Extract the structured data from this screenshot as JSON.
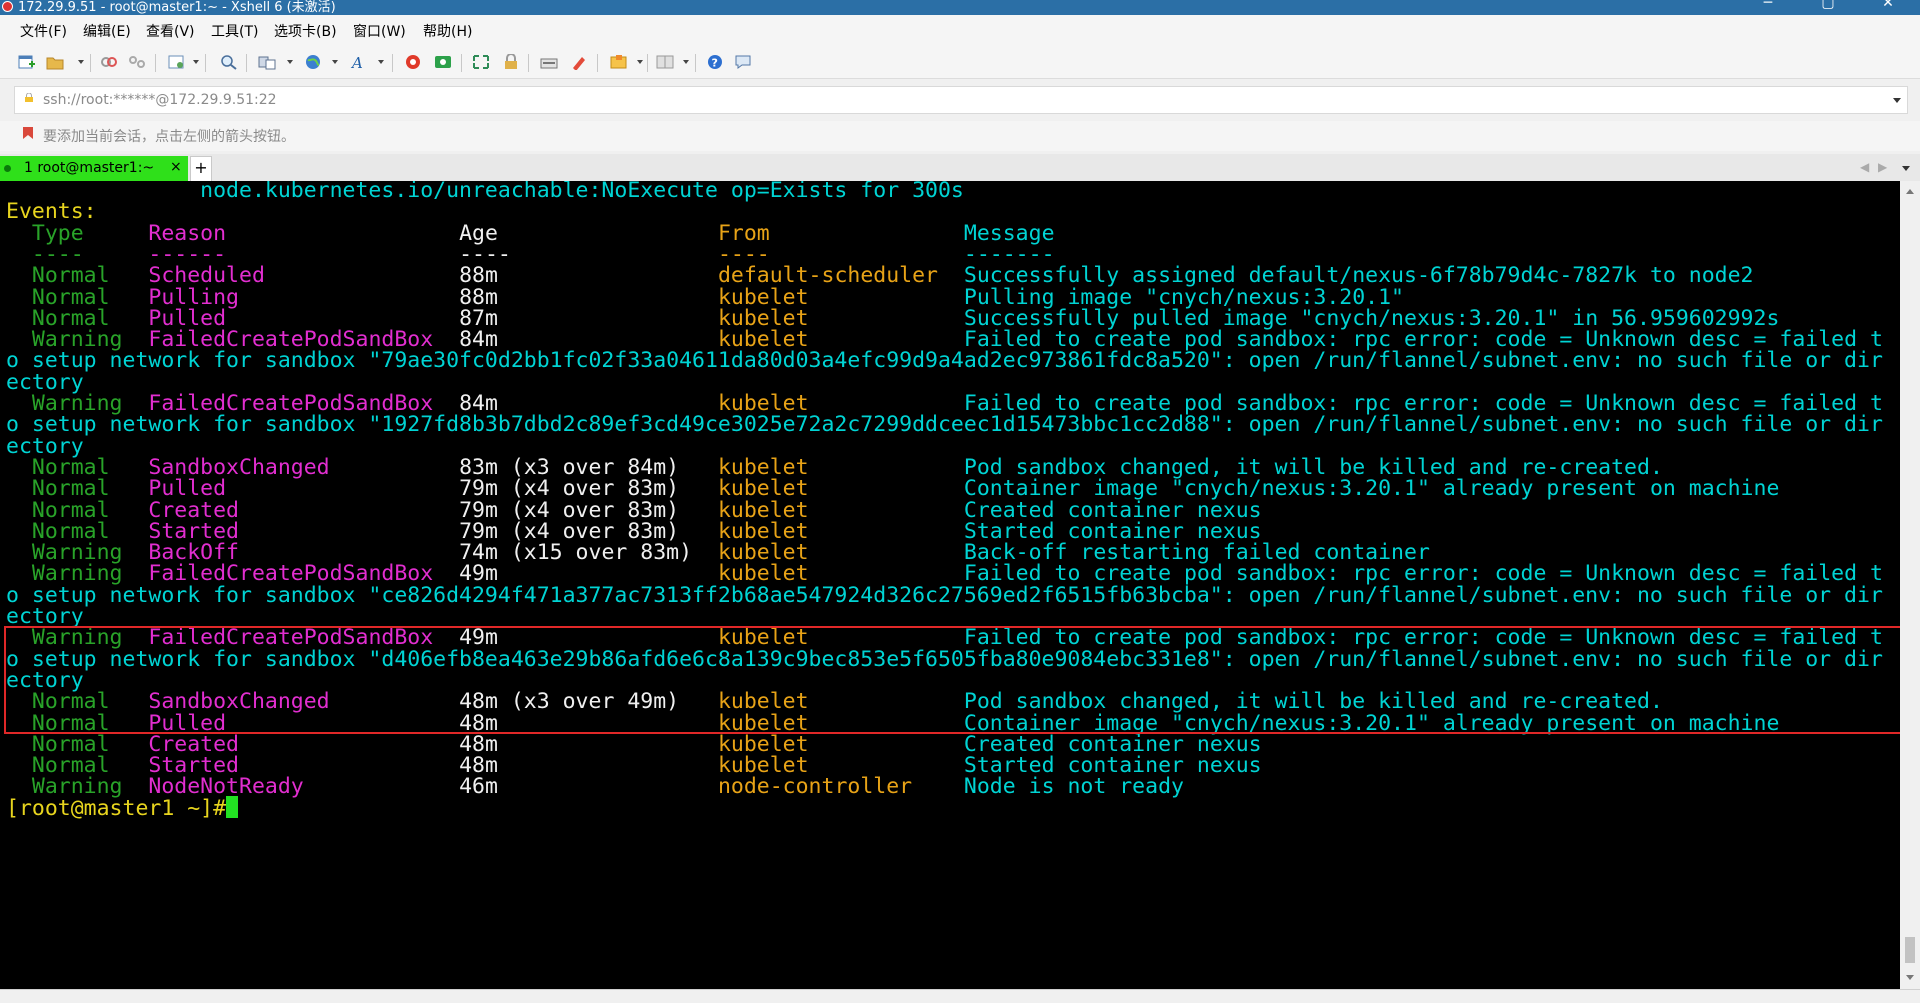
{
  "window": {
    "title": "172.29.9.51 - root@master1:~ - Xshell 6 (未激活)"
  },
  "menu": [
    "文件(F)",
    "编辑(E)",
    "查看(V)",
    "工具(T)",
    "选项卡(B)",
    "窗口(W)",
    "帮助(H)"
  ],
  "address": {
    "value": "ssh://root:******@172.29.9.51:22"
  },
  "hint": {
    "text": "要添加当前会话，点击左侧的箭头按钮。"
  },
  "tabs": {
    "active_label": "1 root@master1:~",
    "close": "×",
    "new": "+"
  },
  "terminal": {
    "lines": [
      [
        {
          "t": "               node.kubernetes.io/unreachable:NoExecute op=Exists for 300s",
          "c": "def"
        }
      ],
      [
        {
          "t": "Events:",
          "c": "yellow"
        }
      ],
      [
        {
          "t": "  Type     ",
          "c": "green"
        },
        {
          "t": "Reason                  ",
          "c": "magenta"
        },
        {
          "t": "Age                 ",
          "c": "white"
        },
        {
          "t": "From               ",
          "c": "orange"
        },
        {
          "t": "Message",
          "c": "msg"
        }
      ],
      [
        {
          "t": "  ----     ",
          "c": "green"
        },
        {
          "t": "------                  ",
          "c": "magenta"
        },
        {
          "t": "----                ",
          "c": "white"
        },
        {
          "t": "----               ",
          "c": "orange"
        },
        {
          "t": "-------",
          "c": "msg"
        }
      ],
      [
        {
          "t": "  Normal   ",
          "c": "green"
        },
        {
          "t": "Scheduled               ",
          "c": "magenta"
        },
        {
          "t": "88m                 ",
          "c": "white"
        },
        {
          "t": "default-scheduler  ",
          "c": "orange"
        },
        {
          "t": "Successfully assigned default/nexus-6f78b79d4c-7827k to node2",
          "c": "msg"
        }
      ],
      [
        {
          "t": "  Normal   ",
          "c": "green"
        },
        {
          "t": "Pulling                 ",
          "c": "magenta"
        },
        {
          "t": "88m                 ",
          "c": "white"
        },
        {
          "t": "kubelet            ",
          "c": "orange"
        },
        {
          "t": "Pulling image \"cnych/nexus:3.20.1\"",
          "c": "msg"
        }
      ],
      [
        {
          "t": "  Normal   ",
          "c": "green"
        },
        {
          "t": "Pulled                  ",
          "c": "magenta"
        },
        {
          "t": "87m                 ",
          "c": "white"
        },
        {
          "t": "kubelet            ",
          "c": "orange"
        },
        {
          "t": "Successfully pulled image \"cnych/nexus:3.20.1\" in 56.959602992s",
          "c": "msg"
        }
      ],
      [
        {
          "t": "  Warning  ",
          "c": "green"
        },
        {
          "t": "FailedCreatePodSandBox  ",
          "c": "magenta"
        },
        {
          "t": "84m                 ",
          "c": "white"
        },
        {
          "t": "kubelet            ",
          "c": "orange"
        },
        {
          "t": "Failed to create pod sandbox: rpc error: code = Unknown desc = failed t",
          "c": "msg"
        }
      ],
      [
        {
          "t": "o setup network for sandbox \"79ae30fc0d2bb1fc02f33a04611da80d03a4efc99d9a4ad2ec973861fdc8a520\": open /run/flannel/subnet.env: no such file or dir",
          "c": "msg"
        }
      ],
      [
        {
          "t": "ectory",
          "c": "msg"
        }
      ],
      [
        {
          "t": "  Warning  ",
          "c": "green"
        },
        {
          "t": "FailedCreatePodSandBox  ",
          "c": "magenta"
        },
        {
          "t": "84m                 ",
          "c": "white"
        },
        {
          "t": "kubelet            ",
          "c": "orange"
        },
        {
          "t": "Failed to create pod sandbox: rpc error: code = Unknown desc = failed t",
          "c": "msg"
        }
      ],
      [
        {
          "t": "o setup network for sandbox \"1927fd8b3b7dbd2c89ef3cd49ce3025e72a2c7299ddceec1d15473bbc1cc2d88\": open /run/flannel/subnet.env: no such file or dir",
          "c": "msg"
        }
      ],
      [
        {
          "t": "ectory",
          "c": "msg"
        }
      ],
      [
        {
          "t": "  Normal   ",
          "c": "green"
        },
        {
          "t": "SandboxChanged          ",
          "c": "magenta"
        },
        {
          "t": "83m (x3 over 84m)   ",
          "c": "white"
        },
        {
          "t": "kubelet            ",
          "c": "orange"
        },
        {
          "t": "Pod sandbox changed, it will be killed and re-created.",
          "c": "msg"
        }
      ],
      [
        {
          "t": "  Normal   ",
          "c": "green"
        },
        {
          "t": "Pulled                  ",
          "c": "magenta"
        },
        {
          "t": "79m (x4 over 83m)   ",
          "c": "white"
        },
        {
          "t": "kubelet            ",
          "c": "orange"
        },
        {
          "t": "Container image \"cnych/nexus:3.20.1\" already present on machine",
          "c": "msg"
        }
      ],
      [
        {
          "t": "  Normal   ",
          "c": "green"
        },
        {
          "t": "Created                 ",
          "c": "magenta"
        },
        {
          "t": "79m (x4 over 83m)   ",
          "c": "white"
        },
        {
          "t": "kubelet            ",
          "c": "orange"
        },
        {
          "t": "Created container nexus",
          "c": "msg"
        }
      ],
      [
        {
          "t": "  Normal   ",
          "c": "green"
        },
        {
          "t": "Started                 ",
          "c": "magenta"
        },
        {
          "t": "79m (x4 over 83m)   ",
          "c": "white"
        },
        {
          "t": "kubelet            ",
          "c": "orange"
        },
        {
          "t": "Started container nexus",
          "c": "msg"
        }
      ],
      [
        {
          "t": "  Warning  ",
          "c": "green"
        },
        {
          "t": "BackOff                 ",
          "c": "magenta"
        },
        {
          "t": "74m (x15 over 83m)  ",
          "c": "white"
        },
        {
          "t": "kubelet            ",
          "c": "orange"
        },
        {
          "t": "Back-off restarting failed container",
          "c": "msg"
        }
      ],
      [
        {
          "t": "  Warning  ",
          "c": "green"
        },
        {
          "t": "FailedCreatePodSandBox  ",
          "c": "magenta"
        },
        {
          "t": "49m                 ",
          "c": "white"
        },
        {
          "t": "kubelet            ",
          "c": "orange"
        },
        {
          "t": "Failed to create pod sandbox: rpc error: code = Unknown desc = failed t",
          "c": "msg"
        }
      ],
      [
        {
          "t": "o setup network for sandbox \"ce826d4294f471a377ac7313ff2b68ae547924d326c27569ed2f6515fb63bcba\": open /run/flannel/subnet.env: no such file or dir",
          "c": "msg"
        }
      ],
      [
        {
          "t": "ectory",
          "c": "msg"
        }
      ],
      [
        {
          "t": "  Warning  ",
          "c": "green"
        },
        {
          "t": "FailedCreatePodSandBox  ",
          "c": "magenta"
        },
        {
          "t": "49m                 ",
          "c": "white"
        },
        {
          "t": "kubelet            ",
          "c": "orange"
        },
        {
          "t": "Failed to create pod sandbox: rpc error: code = Unknown desc = failed t",
          "c": "msg"
        }
      ],
      [
        {
          "t": "o setup network for sandbox \"d406efb8ea463e29b86afd6e6c8a139c9bec853e5f6505fba80e9084ebc331e8\": open /run/flannel/subnet.env: no such file or dir",
          "c": "msg"
        }
      ],
      [
        {
          "t": "ectory",
          "c": "msg"
        }
      ],
      [
        {
          "t": "  Normal   ",
          "c": "green"
        },
        {
          "t": "SandboxChanged          ",
          "c": "magenta"
        },
        {
          "t": "48m (x3 over 49m)   ",
          "c": "white"
        },
        {
          "t": "kubelet            ",
          "c": "orange"
        },
        {
          "t": "Pod sandbox changed, it will be killed and re-created.",
          "c": "msg"
        }
      ],
      [
        {
          "t": "  Normal   ",
          "c": "green"
        },
        {
          "t": "Pulled                  ",
          "c": "magenta"
        },
        {
          "t": "48m                 ",
          "c": "white"
        },
        {
          "t": "kubelet            ",
          "c": "orange"
        },
        {
          "t": "Container image \"cnych/nexus:3.20.1\" already present on machine",
          "c": "msg"
        }
      ],
      [
        {
          "t": "  Normal   ",
          "c": "green"
        },
        {
          "t": "Created                 ",
          "c": "magenta"
        },
        {
          "t": "48m                 ",
          "c": "white"
        },
        {
          "t": "kubelet            ",
          "c": "orange"
        },
        {
          "t": "Created container nexus",
          "c": "msg"
        }
      ],
      [
        {
          "t": "  Normal   ",
          "c": "green"
        },
        {
          "t": "Started                 ",
          "c": "magenta"
        },
        {
          "t": "48m                 ",
          "c": "white"
        },
        {
          "t": "kubelet            ",
          "c": "orange"
        },
        {
          "t": "Started container nexus",
          "c": "msg"
        }
      ],
      [
        {
          "t": "  Warning  ",
          "c": "green"
        },
        {
          "t": "NodeNotReady            ",
          "c": "magenta"
        },
        {
          "t": "46m                 ",
          "c": "white"
        },
        {
          "t": "node-controller    ",
          "c": "orange"
        },
        {
          "t": "Node is not ready",
          "c": "msg"
        }
      ],
      [
        {
          "t": "[root@master1 ~]#",
          "c": "yellow"
        }
      ]
    ]
  },
  "colors": {
    "titlebar": "#2b6fa6",
    "active_tab": "#2fe01a",
    "terminal_bg": "#000000",
    "highlight_box": "#e02828"
  },
  "icons": [
    "new-session-icon",
    "open-icon",
    "connect-icon",
    "disconnect-icon",
    "properties-icon",
    "find-icon",
    "transfer-icon",
    "globe-icon",
    "font-icon",
    "xftp-icon",
    "xmanager-icon",
    "fullscreen-icon",
    "lock-icon",
    "keyboard-icon",
    "highlight-icon",
    "compose-icon",
    "layout-icon",
    "help-icon",
    "chat-icon"
  ]
}
